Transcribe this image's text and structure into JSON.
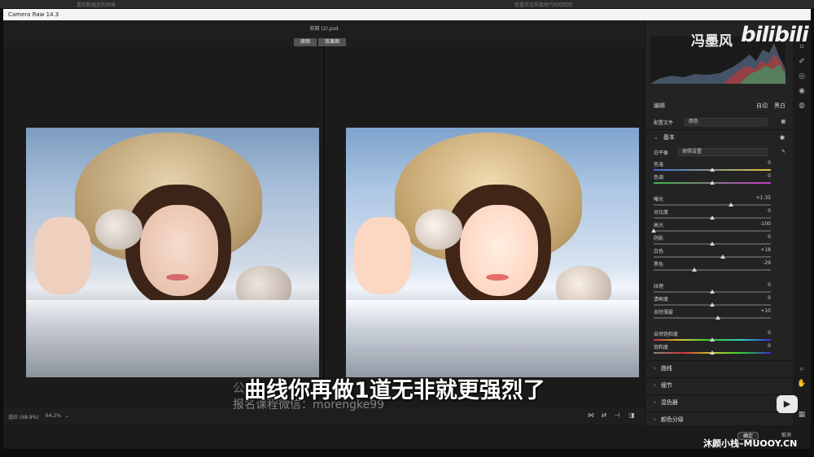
{
  "top_strip": {
    "left_text": "喜欢数据还的风格",
    "right_text": "就喜欢这样接地气的哈哈哈"
  },
  "app_title": "Camera Raw 14.3",
  "file_name": "前期 (2).psd",
  "view_tabs": [
    "原图",
    "效果图"
  ],
  "panel": {
    "edit_label": "编辑",
    "auto_label": "自动",
    "bw_label": "黑白",
    "profile_label": "配置文件",
    "profile_value": "颜色",
    "basic_label": "基本",
    "wb_label": "白平衡",
    "wb_value": "原照设置",
    "sliders": [
      {
        "label": "色温",
        "value": "0",
        "pos": 0.5
      },
      {
        "label": "色调",
        "value": "0",
        "pos": 0.5
      },
      {
        "label": "曝光",
        "value": "+1.35",
        "pos": 0.66
      },
      {
        "label": "对比度",
        "value": "0",
        "pos": 0.5
      },
      {
        "label": "高光",
        "value": "-100",
        "pos": 0.0
      },
      {
        "label": "阴影",
        "value": "0",
        "pos": 0.5
      },
      {
        "label": "白色",
        "value": "+18",
        "pos": 0.59
      },
      {
        "label": "黑色",
        "value": "-29",
        "pos": 0.35
      },
      {
        "label": "纹理",
        "value": "0",
        "pos": 0.5
      },
      {
        "label": "清晰度",
        "value": "0",
        "pos": 0.5
      },
      {
        "label": "去除薄雾",
        "value": "+10",
        "pos": 0.55
      },
      {
        "label": "自然饱和度",
        "value": "0",
        "pos": 0.5
      },
      {
        "label": "饱和度",
        "value": "0",
        "pos": 0.5
      }
    ],
    "sections": [
      "曲线",
      "细节",
      "混色器",
      "颜色分级"
    ]
  },
  "zoom": {
    "fit_label": "适应 (68.9%)",
    "zoom_value": "64.2%"
  },
  "subtitle": "曲线你再做1道无非就更强烈了",
  "watermark": {
    "line1": "公",
    "line2": "报名课程微信：morengke99"
  },
  "logo": {
    "name": "冯墨风",
    "site": "bilibili"
  },
  "brand": "沐颜小栈–MUOOY.CN",
  "bottom_buttons": {
    "ok": "确定",
    "cancel": "取消"
  },
  "colors": {
    "accent": "#2d8ceb",
    "panel_bg": "#232323",
    "titlebar_bg": "#f4f4f4"
  }
}
